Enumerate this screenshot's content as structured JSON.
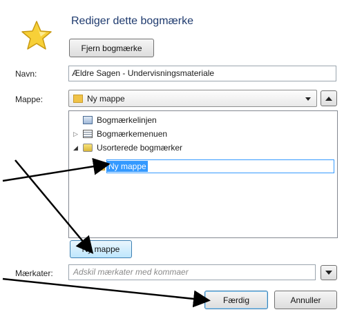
{
  "dialog": {
    "title": "Rediger dette bogmærke",
    "remove_button": "Fjern bogmærke"
  },
  "form": {
    "name_label": "Navn:",
    "name_value": "Ældre Sagen - Undervisningsmateriale",
    "folder_label": "Mappe:",
    "folder_value": "Ny mappe",
    "tags_label": "Mærkater:",
    "tags_placeholder": "Adskil mærkater med kommaer"
  },
  "tree": {
    "items": [
      {
        "label": "Bogmærkelinjen",
        "icon": "toolbar-icon"
      },
      {
        "label": "Bogmærkemenuen",
        "icon": "menu-icon"
      },
      {
        "label": "Usorterede bogmærker",
        "icon": "unsorted-bookmarks-icon"
      },
      {
        "label": "Ny mappe",
        "icon": "folder-icon"
      }
    ]
  },
  "buttons": {
    "new_folder": "Ny mappe",
    "done": "Færdig",
    "cancel": "Annuller"
  },
  "colors": {
    "selection": "#3399ff",
    "highlight_border": "#3c7fb1",
    "star": "#f7d038",
    "folder": "#f0c348"
  }
}
